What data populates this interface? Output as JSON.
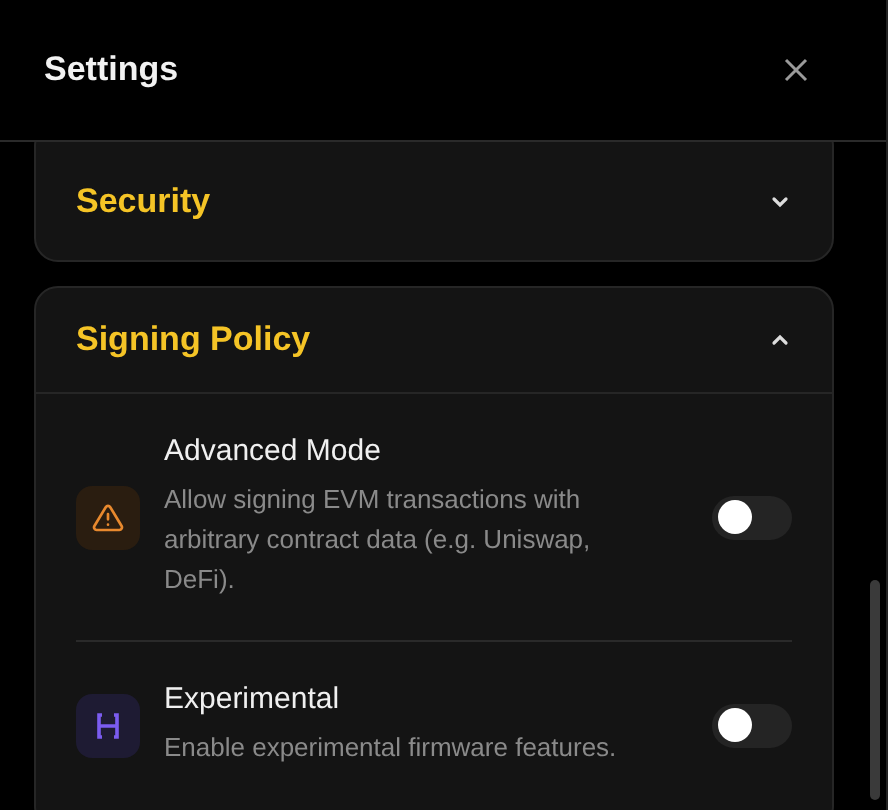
{
  "header": {
    "title": "Settings"
  },
  "sections": [
    {
      "title": "Security",
      "expanded": false
    },
    {
      "title": "Signing Policy",
      "expanded": true,
      "items": [
        {
          "kind": "warning",
          "title": "Advanced Mode",
          "description": "Allow signing EVM transactions with arbitrary contract data (e.g. Uniswap, DeFi).",
          "on": false
        },
        {
          "kind": "experimental",
          "title": "Experimental",
          "description": "Enable experimental firmware features.",
          "on": false
        }
      ]
    }
  ]
}
